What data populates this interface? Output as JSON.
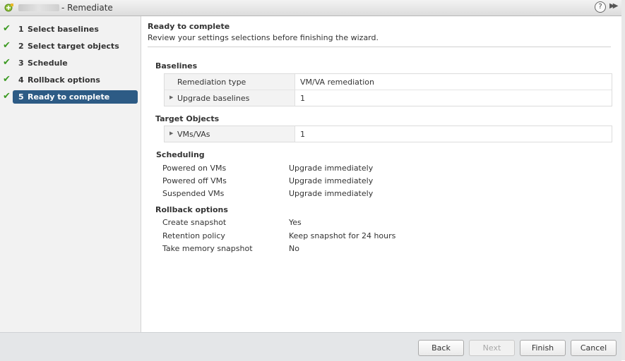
{
  "window": {
    "title": "- Remediate",
    "help_label": "?",
    "expand_label": "▶▶"
  },
  "steps": [
    {
      "num": "1",
      "label": "Select baselines"
    },
    {
      "num": "2",
      "label": "Select target objects"
    },
    {
      "num": "3",
      "label": "Schedule"
    },
    {
      "num": "4",
      "label": "Rollback options"
    },
    {
      "num": "5",
      "label": "Ready to complete"
    }
  ],
  "check_glyph": "✔",
  "main": {
    "title": "Ready to complete",
    "subtitle": "Review your settings selections before finishing the wizard.",
    "baselines": {
      "heading": "Baselines",
      "rows": [
        {
          "key": "Remediation type",
          "value": "VM/VA remediation"
        },
        {
          "key": "Upgrade baselines",
          "value": "1"
        }
      ]
    },
    "targets": {
      "heading": "Target Objects",
      "rows": [
        {
          "key": "VMs/VAs",
          "value": "1"
        }
      ]
    },
    "scheduling": {
      "heading": "Scheduling",
      "rows": [
        {
          "key": "Powered on VMs",
          "value": "Upgrade immediately"
        },
        {
          "key": "Powered off VMs",
          "value": "Upgrade immediately"
        },
        {
          "key": "Suspended VMs",
          "value": "Upgrade immediately"
        }
      ]
    },
    "rollback": {
      "heading": "Rollback options",
      "rows": [
        {
          "key": "Create snapshot",
          "value": "Yes"
        },
        {
          "key": "Retention policy",
          "value": "Keep snapshot for 24 hours"
        },
        {
          "key": "Take memory snapshot",
          "value": "No"
        }
      ]
    }
  },
  "footer": {
    "back": "Back",
    "next": "Next",
    "finish": "Finish",
    "cancel": "Cancel"
  },
  "colors": {
    "active_step": "#2d5b85",
    "check": "#3c9a22"
  }
}
